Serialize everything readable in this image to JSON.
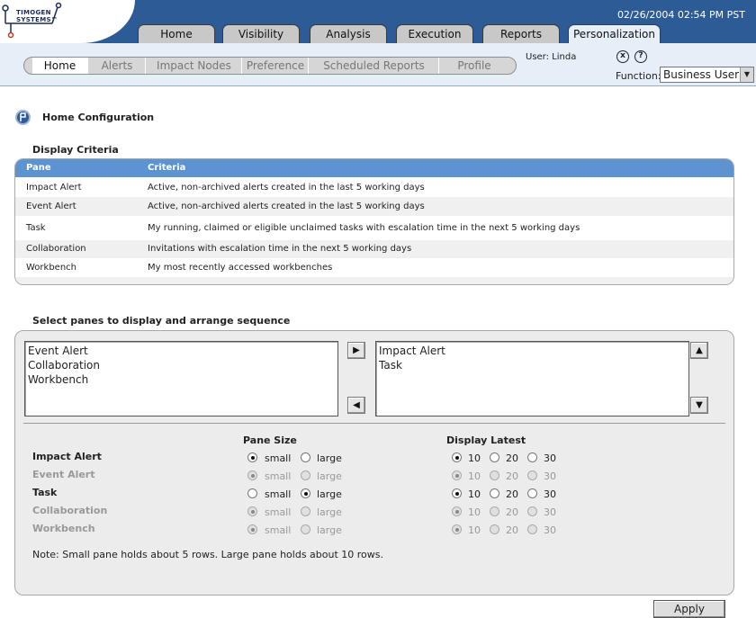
{
  "header": {
    "logo_text": "TIMOGEN\nSYSTEMS™",
    "datetime": "02/26/2004 02:54 PM PST",
    "tabs": [
      {
        "label": "Home"
      },
      {
        "label": "Visibility"
      },
      {
        "label": "Analysis"
      },
      {
        "label": "Execution"
      },
      {
        "label": "Reports"
      },
      {
        "label": "Personalization",
        "active": true
      }
    ]
  },
  "subnav": {
    "items": [
      {
        "label": "Home",
        "active": true
      },
      {
        "label": "Alerts"
      },
      {
        "label": "Impact Nodes"
      },
      {
        "label": "Preference"
      },
      {
        "label": "Scheduled Reports"
      },
      {
        "label": "Profile"
      }
    ],
    "user": "User: Linda",
    "function_label": "Function:",
    "function_value": "Business User",
    "close_glyph": "x",
    "help_glyph": "?"
  },
  "page": {
    "title": "Home Configuration",
    "display_criteria_title": "Display Criteria",
    "criteria_headers": [
      "Pane",
      "Criteria"
    ],
    "criteria_rows": [
      {
        "pane": "Impact Alert",
        "criteria": "Active, non-archived alerts created in the last 5 working days"
      },
      {
        "pane": "Event Alert",
        "criteria": "Active, non-archived alerts created in the last 5 working days"
      },
      {
        "pane": "Task",
        "criteria": "My running, claimed or eligible unclaimed tasks with escalation time in the next 5 working days"
      },
      {
        "pane": "Collaboration",
        "criteria": "Invitations with escalation time in the next 5 working days"
      },
      {
        "pane": "Workbench",
        "criteria": "My most recently accessed workbenches"
      }
    ],
    "select_title": "Select panes to display and arrange sequence",
    "available_list": [
      "Event Alert",
      "Collaboration",
      "Workbench"
    ],
    "selected_list": [
      "Impact Alert",
      "Task"
    ],
    "pane_size_header": "Pane Size",
    "display_latest_header": "Display Latest",
    "size_options": [
      "small",
      "large"
    ],
    "latest_options": [
      "10",
      "20",
      "30"
    ],
    "panes": [
      {
        "name": "Impact Alert",
        "enabled": true,
        "size": "small",
        "latest": "10"
      },
      {
        "name": "Event Alert",
        "enabled": false,
        "size": "small",
        "latest": "10"
      },
      {
        "name": "Task",
        "enabled": true,
        "size": "large",
        "latest": "10"
      },
      {
        "name": "Collaboration",
        "enabled": false,
        "size": "small",
        "latest": "10"
      },
      {
        "name": "Workbench",
        "enabled": false,
        "size": "small",
        "latest": "10"
      }
    ],
    "note": "Note: Small pane holds about 5 rows. Large pane holds about 10 rows.",
    "apply_label": "Apply"
  },
  "colors": {
    "header_blue": "#2c5b96",
    "table_header": "#5c93d0",
    "subnav_bg": "#e6eef7"
  }
}
